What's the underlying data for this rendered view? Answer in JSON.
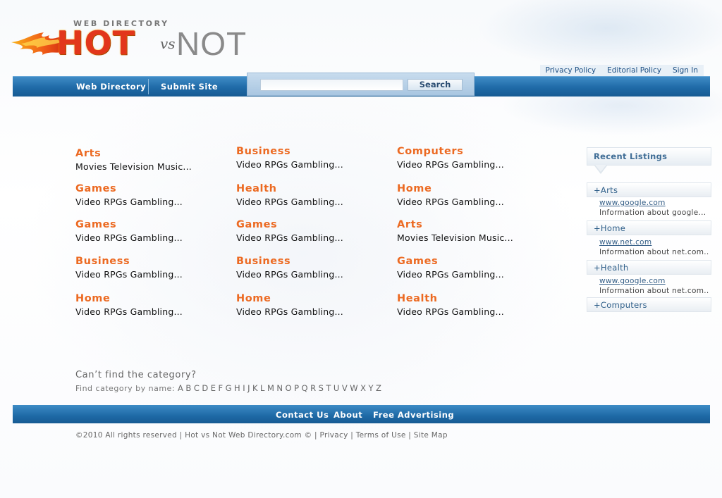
{
  "logo": {
    "tagline": "WEB DIRECTORY",
    "hot": "HOT",
    "vs": "vs",
    "not": "NOT"
  },
  "top_links": [
    "Privacy Policy",
    "Editorial Policy",
    "Sign In"
  ],
  "nav": {
    "items": [
      "Web Directory",
      "Submit Site"
    ],
    "search_value": "",
    "search_button": "Search"
  },
  "categories": [
    {
      "title": "Arts",
      "desc": "Movies Television Music..."
    },
    {
      "title": "Business",
      "desc": "Video RPGs Gambling..."
    },
    {
      "title": "Computers",
      "desc": "Video RPGs Gambling..."
    },
    {
      "title": "Games",
      "desc": "Video RPGs Gambling..."
    },
    {
      "title": "Health",
      "desc": "Video RPGs Gambling..."
    },
    {
      "title": "Home",
      "desc": "Video RPGs Gambling..."
    },
    {
      "title": "Games",
      "desc": "Video RPGs Gambling..."
    },
    {
      "title": "Games",
      "desc": "Video RPGs Gambling..."
    },
    {
      "title": "Arts",
      "desc": "Movies Television Music..."
    },
    {
      "title": "Business",
      "desc": "Video RPGs Gambling..."
    },
    {
      "title": "Business",
      "desc": "Video RPGs Gambling..."
    },
    {
      "title": "Games",
      "desc": "Video RPGs Gambling..."
    },
    {
      "title": "Home",
      "desc": "Video RPGs Gambling..."
    },
    {
      "title": "Home",
      "desc": "Video RPGs Gambling..."
    },
    {
      "title": "Health",
      "desc": "Video RPGs Gambling..."
    }
  ],
  "recent": {
    "title": "Recent Listings",
    "items": [
      {
        "category": "+Arts",
        "url": "www.google.com",
        "info": "Information about google..."
      },
      {
        "category": "+Home",
        "url": "www.net.com",
        "info": "Information about net.com.."
      },
      {
        "category": "+Health",
        "url": "www.google.com",
        "info": "Information about net.com.."
      },
      {
        "category": "+Computers"
      }
    ]
  },
  "cant_find": {
    "heading": "Can’t find the category?",
    "prompt": "Find category by name:",
    "letters": [
      "A",
      "B",
      "C",
      "D",
      "E",
      "F",
      "G",
      "H",
      "I",
      "J",
      "K",
      "L",
      "M",
      "N",
      "O",
      "P",
      "Q",
      "R",
      "S",
      "T",
      "U",
      "V",
      "W",
      "X",
      "Y",
      "Z"
    ]
  },
  "footer": {
    "links": [
      "Contact Us",
      "About",
      "Free Advertising"
    ],
    "copyright": "©2010 All rights reserved | Hot vs Not Web Directory.com © | Privacy | Terms of Use | Site Map"
  },
  "colors": {
    "accent_orange": "#ec6a22",
    "nav_blue": "#1f6aa7",
    "link_blue": "#1d4f83"
  }
}
